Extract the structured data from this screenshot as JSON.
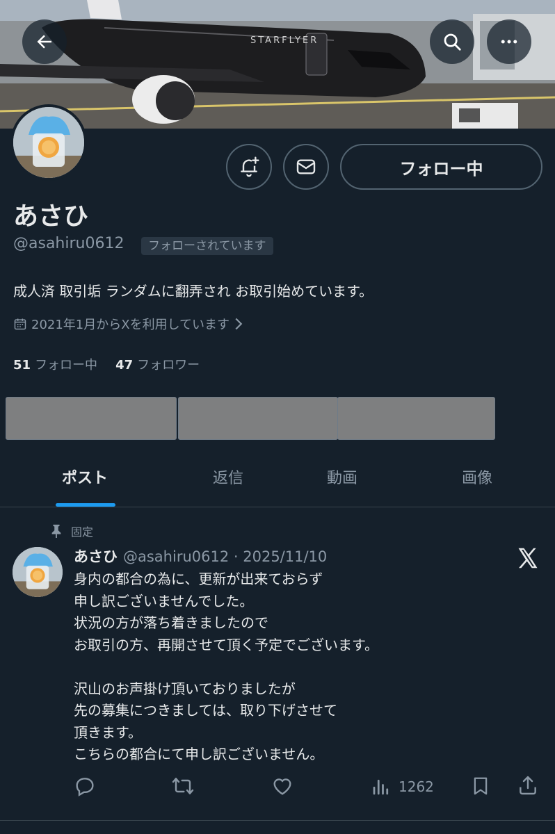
{
  "banner": {
    "airline_text": "STARFLYER"
  },
  "header": {
    "back_icon": "arrow-left-icon",
    "search_icon": "search-icon",
    "more_icon": "ellipsis-icon"
  },
  "profile": {
    "display_name": "あさひ",
    "handle": "@asahiru0612",
    "follows_you_label": "フォローされています",
    "bio": "成人済 取引垢 ランダムに翻弄され お取引始めています。",
    "joined": "2021年1月からXを利用しています",
    "following_count": "51",
    "following_label": "フォロー中",
    "followers_count": "47",
    "followers_label": "フォロワー",
    "follow_button_label": "フォロー中"
  },
  "tabs": [
    {
      "label": "ポスト",
      "active": true
    },
    {
      "label": "返信",
      "active": false
    },
    {
      "label": "動画",
      "active": false
    },
    {
      "label": "画像",
      "active": false
    }
  ],
  "post": {
    "pinned_label": "固定",
    "author_name": "あさひ",
    "meta": "@asahiru0612 · 2025/11/10",
    "body": "身内の都合の為に、更新が出来ておらず\n申し訳ございませんでした。\n状況の方が落ち着きましたので\nお取引の方、再開させて頂く予定でございます。\n\n沢山のお声掛け頂いておりましたが\n先の募集につきましては、取り下げさせて\n頂きます。\nこちらの都合にて申し訳ございません。",
    "views": "1262"
  },
  "colors": {
    "background": "#15202b",
    "accent": "#1d9bf0",
    "muted_text": "#8b98a5",
    "border": "#536471"
  }
}
